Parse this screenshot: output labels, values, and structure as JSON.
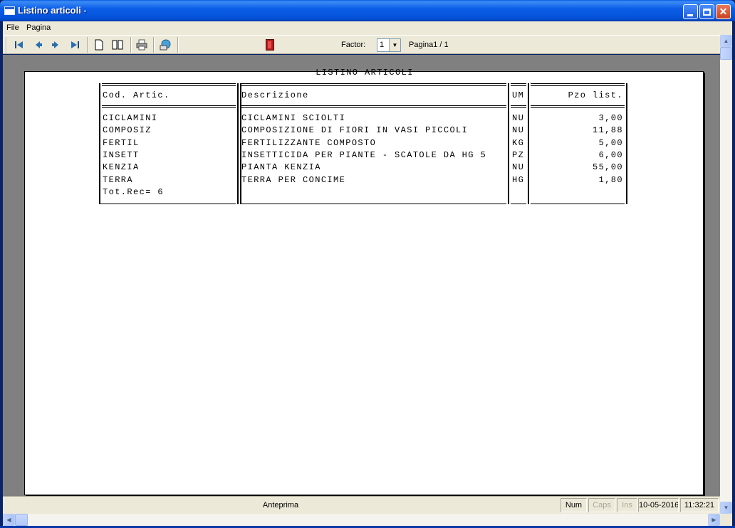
{
  "window": {
    "title": "Listino articoli",
    "title_mark": "▫"
  },
  "menu": [
    "File",
    "Pagina"
  ],
  "toolbar": {
    "factor_label": "Factor:",
    "factor_value": "1",
    "page_label": "Pagina1 / 1",
    "icons": [
      "first-page-icon",
      "prev-page-icon",
      "next-page-icon",
      "last-page-icon",
      "single-page-icon",
      "two-pages-icon",
      "print-icon",
      "export-icon",
      "exit-icon"
    ]
  },
  "report": {
    "title": "LISTINO ARTICOLI",
    "headers": {
      "code": "Cod. Artic.",
      "description": "Descrizione",
      "um": "UM",
      "price": "Pzo list."
    },
    "rows": [
      {
        "code": "CICLAMINI",
        "description": "CICLAMINI SCIOLTI",
        "um": "NU",
        "price": "3,00"
      },
      {
        "code": "COMPOSIZ",
        "description": "COMPOSIZIONE DI FIORI IN VASI PICCOLI",
        "um": "NU",
        "price": "11,88"
      },
      {
        "code": "FERTIL",
        "description": "FERTILIZZANTE COMPOSTO",
        "um": "KG",
        "price": "5,00"
      },
      {
        "code": "INSETT",
        "description": "INSETTICIDA PER PIANTE - SCATOLE DA HG 5",
        "um": "PZ",
        "price": "6,00"
      },
      {
        "code": "KENZIA",
        "description": "PIANTA KENZIA",
        "um": "NU",
        "price": "55,00"
      },
      {
        "code": "TERRA",
        "description": "TERRA PER CONCIME",
        "um": "HG",
        "price": "1,80"
      }
    ],
    "total": "Tot.Rec= 6"
  },
  "status": {
    "center": "Anteprima",
    "num": "Num",
    "caps": "Caps",
    "ins": "Ins",
    "date": "10-05-2016",
    "time": "11:32:21"
  },
  "colors": {
    "titlebar": "#0450d5",
    "chrome": "#ece9d8",
    "preview_bg": "#808080"
  }
}
